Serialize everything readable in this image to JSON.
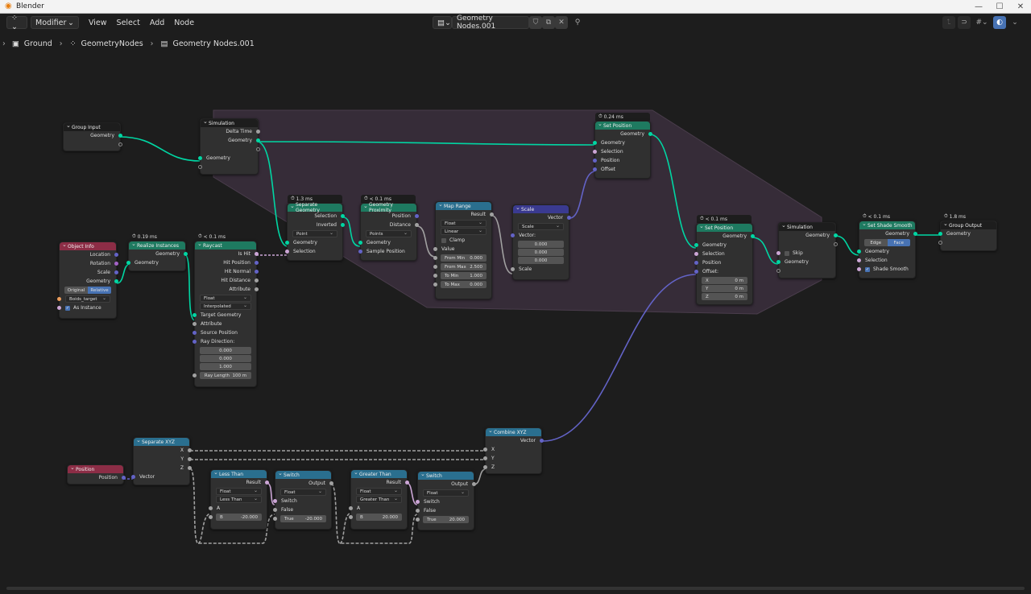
{
  "window": {
    "title": "Blender",
    "controls": [
      "—",
      "☐",
      "✕"
    ]
  },
  "header": {
    "editor_type_icon": "geometry-nodes-icon",
    "context_dropdown": "Modifier",
    "menus": [
      "View",
      "Select",
      "Add",
      "Node"
    ],
    "node_tree_name": "Geometry Nodes.001",
    "right_icons": [
      "parent-node-tree-icon",
      "snap-icon",
      "snap-target-icon",
      "overlay-icon"
    ]
  },
  "breadcrumb": [
    {
      "icon": "object-icon",
      "label": "Ground"
    },
    {
      "icon": "modifier-icon",
      "label": "GeometryNodes"
    },
    {
      "icon": "node-tree-icon",
      "label": "Geometry Nodes.001"
    }
  ],
  "nodes": {
    "group_input": {
      "title": "Group Input",
      "outputs": [
        "Geometry"
      ]
    },
    "sim_input": {
      "title": "Simulation",
      "outputs": [
        "Delta Time",
        "Geometry"
      ],
      "inputs": [
        "Geometry"
      ]
    },
    "object_info": {
      "title": "Object Info",
      "outputs": [
        "Location",
        "Rotation",
        "Scale",
        "Geometry"
      ],
      "mode_options": [
        "Original",
        "Relative"
      ],
      "mode_selected": "Relative",
      "object": "Boids_target",
      "as_instance_label": "As Instance",
      "as_instance": true
    },
    "realize_instances": {
      "timing": "0.19 ms",
      "title": "Realize Instances",
      "outputs": [
        "Geometry"
      ],
      "inputs": [
        "Geometry"
      ]
    },
    "raycast": {
      "timing": "< 0.1 ms",
      "title": "Raycast",
      "outputs": [
        "Is Hit",
        "Hit Position",
        "Hit Normal",
        "Hit Distance",
        "Attribute"
      ],
      "data_type": "Float",
      "mapping": "Interpolated",
      "inputs": [
        "Target Geometry",
        "Attribute",
        "Source Position",
        "Ray Direction:"
      ],
      "ray_direction": [
        "0.000",
        "0.000",
        "1.000"
      ],
      "ray_length_label": "Ray Length",
      "ray_length": "100 m"
    },
    "separate_geometry": {
      "timing": "1.3 ms",
      "title": "Separate Geometry",
      "outputs": [
        "Selection",
        "Inverted"
      ],
      "domain": "Point",
      "inputs": [
        "Geometry",
        "Selection"
      ]
    },
    "geometry_proximity": {
      "timing": "< 0.1 ms",
      "title": "Geometry Proximity",
      "outputs": [
        "Position",
        "Distance"
      ],
      "target": "Points",
      "inputs": [
        "Geometry",
        "Sample Position"
      ]
    },
    "map_range": {
      "title": "Map Range",
      "outputs": [
        "Result"
      ],
      "data_type": "Float",
      "interpolation": "Linear",
      "clamp_label": "Clamp",
      "clamp": false,
      "inputs": [
        "Value"
      ],
      "fields": [
        {
          "label": "From Min",
          "value": "0.000"
        },
        {
          "label": "From Max",
          "value": "2.500"
        },
        {
          "label": "To Min",
          "value": "1.000"
        },
        {
          "label": "To Max",
          "value": "0.000"
        }
      ]
    },
    "scale": {
      "title": "Scale",
      "outputs": [
        "Vector"
      ],
      "operation": "Scale",
      "vector_label": "Vector:",
      "vector": [
        "0.000",
        "0.000",
        "0.000"
      ],
      "inputs": [
        "Scale"
      ]
    },
    "set_position_1": {
      "timing": "0.24 ms",
      "title": "Set Position",
      "outputs": [
        "Geometry"
      ],
      "inputs": [
        "Geometry",
        "Selection",
        "Position",
        "Offset"
      ]
    },
    "set_position_2": {
      "timing": "< 0.1 ms",
      "title": "Set Position",
      "outputs": [
        "Geometry"
      ],
      "inputs": [
        "Geometry",
        "Selection",
        "Position",
        "Offset:"
      ],
      "offset": [
        {
          "label": "X",
          "value": "0 m"
        },
        {
          "label": "Y",
          "value": "0 m"
        },
        {
          "label": "Z",
          "value": "0 m"
        }
      ]
    },
    "sim_output": {
      "title": "Simulation",
      "outputs": [
        "Geometry"
      ],
      "skip_label": "Skip",
      "inputs": [
        "Geometry"
      ]
    },
    "set_shade_smooth": {
      "timing": "< 0.1 ms",
      "title": "Set Shade Smooth",
      "outputs": [
        "Geometry"
      ],
      "domain_options": [
        "Edge",
        "Face"
      ],
      "domain_selected": "Face",
      "inputs": [
        "Geometry",
        "Selection"
      ],
      "shade_smooth_label": "Shade Smooth",
      "shade_smooth": true
    },
    "group_output": {
      "timing": "1.8 ms",
      "title": "Group Output",
      "inputs": [
        "Geometry"
      ]
    },
    "position": {
      "title": "Position",
      "outputs": [
        "Position"
      ]
    },
    "separate_xyz": {
      "title": "Separate XYZ",
      "outputs": [
        "X",
        "Y",
        "Z"
      ],
      "inputs": [
        "Vector"
      ]
    },
    "combine_xyz": {
      "title": "Combine XYZ",
      "outputs": [
        "Vector"
      ],
      "inputs": [
        "X",
        "Y",
        "Z"
      ]
    },
    "less_than": {
      "title": "Less Than",
      "outputs": [
        "Result"
      ],
      "data_type": "Float",
      "operation": "Less Than",
      "inputs": [
        "A"
      ],
      "b_label": "B",
      "b": "-20.000"
    },
    "switch_1": {
      "title": "Switch",
      "outputs": [
        "Output"
      ],
      "data_type": "Float",
      "inputs": [
        "Switch",
        "False"
      ],
      "true_label": "True",
      "true": "-20.000"
    },
    "greater_than": {
      "title": "Greater Than",
      "outputs": [
        "Result"
      ],
      "data_type": "Float",
      "operation": "Greater Than",
      "inputs": [
        "A"
      ],
      "b_label": "B",
      "b": "20.000"
    },
    "switch_2": {
      "title": "Switch",
      "outputs": [
        "Output"
      ],
      "data_type": "Float",
      "inputs": [
        "Switch",
        "False"
      ],
      "true_label": "True",
      "true": "20.000"
    }
  },
  "colors": {
    "geometry_link": "#00d6a3",
    "vector_link": "#6363c7",
    "float_link": "#a1a1a1",
    "bool_link": "#cca6d6",
    "sim_zone": "#3a2e3c"
  }
}
